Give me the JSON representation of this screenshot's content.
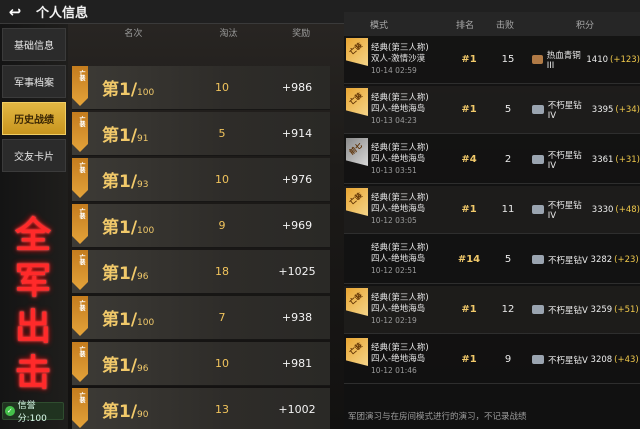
{
  "header": {
    "back_icon": "back-arrow-icon",
    "title": "个人信息"
  },
  "sidebar": {
    "items": [
      {
        "label": "基础信息",
        "active": false
      },
      {
        "label": "军事档案",
        "active": false
      },
      {
        "label": "历史战绩",
        "active": true
      },
      {
        "label": "交友卡片",
        "active": false
      }
    ],
    "slogan": [
      "全",
      "军",
      "出",
      "击"
    ],
    "credit": "信誉分:100"
  },
  "left_table": {
    "headers": [
      "名次",
      "淘汰",
      "奖励"
    ],
    "rows": [
      {
        "tag": "亡装",
        "rank": "第1/",
        "total": "100",
        "kills": "10",
        "reward": "+986"
      },
      {
        "tag": "亡装",
        "rank": "第1/",
        "total": "91",
        "kills": "5",
        "reward": "+914"
      },
      {
        "tag": "亡装",
        "rank": "第1/",
        "total": "93",
        "kills": "10",
        "reward": "+976"
      },
      {
        "tag": "亡装",
        "rank": "第1/",
        "total": "100",
        "kills": "9",
        "reward": "+969"
      },
      {
        "tag": "亡装",
        "rank": "第1/",
        "total": "96",
        "kills": "18",
        "reward": "+1025"
      },
      {
        "tag": "亡装",
        "rank": "第1/",
        "total": "100",
        "kills": "7",
        "reward": "+938"
      },
      {
        "tag": "亡装",
        "rank": "第1/",
        "total": "96",
        "kills": "10",
        "reward": "+981"
      },
      {
        "tag": "亡装",
        "rank": "第1/",
        "total": "90",
        "kills": "13",
        "reward": "+1002"
      }
    ]
  },
  "right_table": {
    "headers": [
      "模式",
      "排名",
      "击败",
      "积分"
    ],
    "rows": [
      {
        "badge": "亡装",
        "mode": "经典(第三人称)",
        "map": "双人-激情沙漠",
        "date": "10-14 02:59",
        "rank": "#1",
        "kills": "15",
        "tier": "热血青铜III",
        "points": "1410",
        "delta": "(+123)",
        "tier_color": "bronze"
      },
      {
        "badge": "亡装",
        "mode": "经典(第三人称)",
        "map": "四人-绝地海岛",
        "date": "10-13 04:23",
        "rank": "#1",
        "kills": "5",
        "tier": "不朽星钻IV",
        "points": "3395",
        "delta": "(+34)",
        "tier_color": "silver"
      },
      {
        "badge": "前七",
        "mode": "经典(第三人称)",
        "map": "四人-绝地海岛",
        "date": "10-13 03:51",
        "rank": "#4",
        "kills": "2",
        "tier": "不朽星钻IV",
        "points": "3361",
        "delta": "(+31)",
        "tier_color": "silver"
      },
      {
        "badge": "亡装",
        "mode": "经典(第三人称)",
        "map": "四人-绝地海岛",
        "date": "10-12 03:05",
        "rank": "#1",
        "kills": "11",
        "tier": "不朽星钻IV",
        "points": "3330",
        "delta": "(+48)",
        "tier_color": "silver"
      },
      {
        "badge": "",
        "mode": "经典(第三人称)",
        "map": "四人-绝地海岛",
        "date": "10-12 02:51",
        "rank": "#14",
        "kills": "5",
        "tier": "不朽星钻V",
        "points": "3282",
        "delta": "(+23)",
        "tier_color": "silver"
      },
      {
        "badge": "亡装",
        "mode": "经典(第三人称)",
        "map": "四人-绝地海岛",
        "date": "10-12 02:19",
        "rank": "#1",
        "kills": "12",
        "tier": "不朽星钻V",
        "points": "3259",
        "delta": "(+51)",
        "tier_color": "silver"
      },
      {
        "badge": "亡装",
        "mode": "经典(第三人称)",
        "map": "四人-绝地海岛",
        "date": "10-12 01:46",
        "rank": "#1",
        "kills": "9",
        "tier": "不朽星钻V",
        "points": "3208",
        "delta": "(+43)",
        "tier_color": "silver"
      }
    ],
    "footnote": "军团演习与在房间模式进行的演习，不记录战绩"
  }
}
